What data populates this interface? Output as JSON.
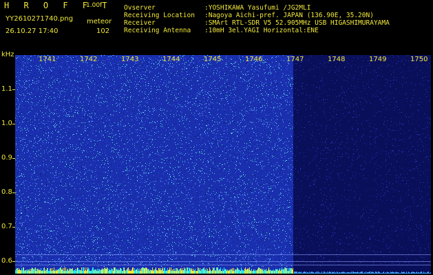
{
  "header": {
    "logo": "H R O F F T",
    "version": "1.00f",
    "filename": "YY2610271740.png",
    "mode": "meteor",
    "datetime": "26.10.27 17:40",
    "count": "102"
  },
  "info": {
    "labels": [
      "Ovserver",
      "Receiving Location",
      "Receiver",
      "Receiving Antenna"
    ],
    "values": [
      ":YOSHIKAWA Yasufumi /JG2MLI",
      ":Nagoya Aichi-pref. JAPAN (136.90E, 35.20N)",
      ":SMArt RTL-SDR V5 52.905MHz USB HIGASHIMURAYAMA",
      ":10mH 3el.YAGI Horizontal:ENE"
    ]
  },
  "axis": {
    "unit": "kHz",
    "y_ticks": [
      "1.1",
      "1.0",
      "0.9",
      "0.8",
      "0.7",
      "0.6"
    ],
    "x_ticks": [
      "1741",
      "1742",
      "1743",
      "1744",
      "1745",
      "1746",
      "1747",
      "1748",
      "1749",
      "1750"
    ]
  },
  "colors": {
    "text": "#f2e93a",
    "background": "#000000",
    "waterfall_active": "#1a2fae",
    "waterfall_inactive": "#0a0f5a",
    "signal_bar": "#22e8ff"
  }
}
